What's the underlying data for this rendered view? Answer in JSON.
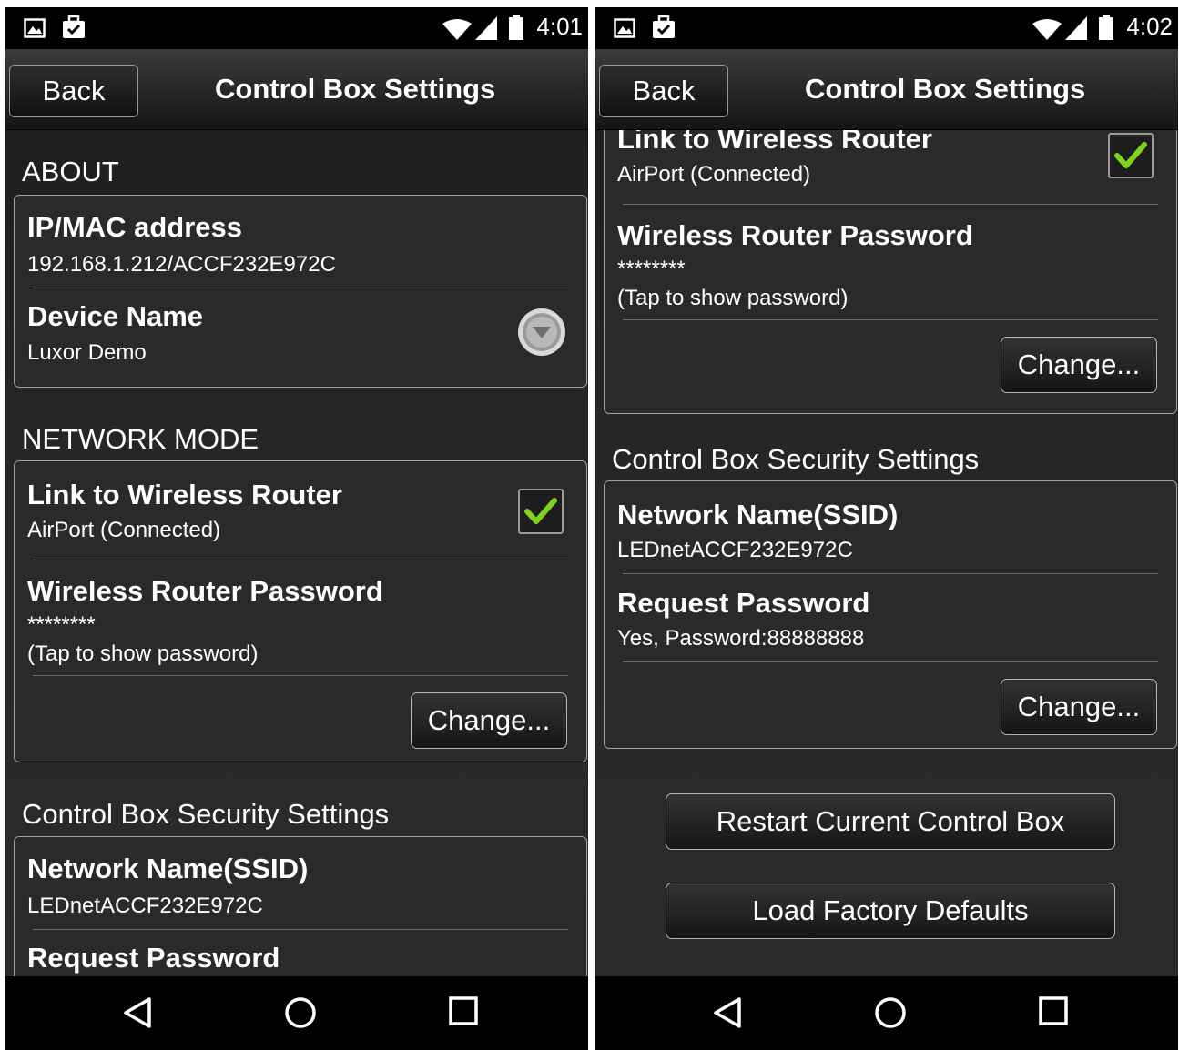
{
  "left": {
    "status": {
      "time": "4:01"
    },
    "toolbar": {
      "back_label": "Back",
      "title": "Control Box Settings"
    },
    "about": {
      "header": "ABOUT",
      "ip_title": "IP/MAC address",
      "ip_value": "192.168.1.212/ACCF232E972C",
      "device_title": "Device Name",
      "device_value": "Luxor Demo"
    },
    "network": {
      "header": "NETWORK MODE",
      "link_title": "Link to Wireless Router",
      "link_value": "AirPort (Connected)",
      "link_checked": true,
      "pw_title": "Wireless Router Password",
      "pw_masked": "********",
      "pw_hint": "(Tap to show password)",
      "change_label": "Change..."
    },
    "security": {
      "header": "Control Box Security Settings",
      "ssid_title": "Network Name(SSID)",
      "ssid_value": "LEDnetACCF232E972C",
      "req_title": "Request Password"
    }
  },
  "right": {
    "status": {
      "time": "4:02"
    },
    "toolbar": {
      "back_label": "Back",
      "title": "Control Box Settings"
    },
    "network": {
      "link_title": "Link to Wireless Router",
      "link_value": "AirPort (Connected)",
      "link_checked": true,
      "pw_title": "Wireless Router Password",
      "pw_masked": "********",
      "pw_hint": "(Tap to show password)",
      "change_label": "Change..."
    },
    "security": {
      "header": "Control Box Security Settings",
      "ssid_title": "Network Name(SSID)",
      "ssid_value": "LEDnetACCF232E972C",
      "req_title": "Request Password",
      "req_value": "Yes, Password:88888888",
      "change_label": "Change..."
    },
    "actions": {
      "restart_label": "Restart Current Control Box",
      "factory_label": "Load Factory Defaults"
    }
  },
  "colors": {
    "check": "#7ed321",
    "accent_border": "#a0a0a0"
  }
}
